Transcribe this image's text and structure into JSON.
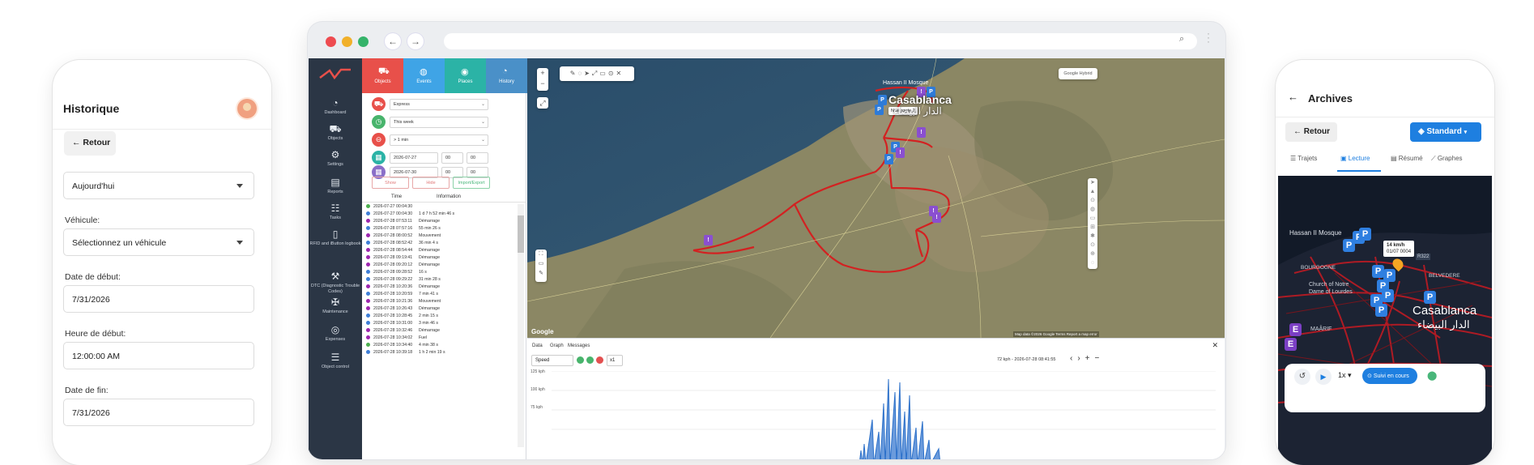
{
  "left_phone": {
    "title": "Historique",
    "back_label": "Retour",
    "period_value": "Aujourd'hui",
    "vehicle_label": "Véhicule:",
    "vehicle_value": "Sélectionnez un véhicule",
    "start_date_label": "Date de début:",
    "start_date_value": "7/31/2026",
    "start_time_label": "Heure de début:",
    "start_time_value": "12:00:00 AM",
    "end_date_label": "Date de fin:",
    "end_date_value": "7/31/2026"
  },
  "app": {
    "nav": [
      {
        "icon": "dashboard-icon",
        "label": "Dashboard"
      },
      {
        "icon": "car-icon",
        "label": "Objects"
      },
      {
        "icon": "gear-icon",
        "label": "Settings"
      },
      {
        "icon": "report-icon",
        "label": "Reports"
      },
      {
        "icon": "tasks-icon",
        "label": "Tasks"
      },
      {
        "icon": "book-icon",
        "label": "RFID and iButton logbook"
      },
      {
        "icon": "engine-icon",
        "label": "DTC (Diagnostic Trouble Codes)"
      },
      {
        "icon": "wrench-icon",
        "label": "Maintenance"
      },
      {
        "icon": "coins-icon",
        "label": "Expenses"
      },
      {
        "icon": "sliders-icon",
        "label": "Object control"
      }
    ],
    "tabs": [
      {
        "label": "Objects",
        "color": "#e8504a"
      },
      {
        "label": "Events",
        "color": "#3fa4e6"
      },
      {
        "label": "Places",
        "color": "#2bb3a6"
      },
      {
        "label": "History",
        "color": "#4a90c8"
      }
    ],
    "filters": {
      "object": "Express",
      "period": "This week",
      "stops": "> 1 min",
      "date_from": "2026-07-27",
      "date_to": "2026-07-30",
      "hour": "00",
      "minute": "00"
    },
    "buttons": {
      "show": "Show",
      "hide": "Hide",
      "import_export": "Import/Export"
    },
    "history_headers": {
      "time": "Time",
      "information": "Information"
    },
    "history_rows": [
      {
        "time": "2026-07-27 00:04:30",
        "info": "",
        "color": "#4caf50"
      },
      {
        "time": "2026-07-27 00:04:30",
        "info": "1 d 7 h 52 min 46 s",
        "color": "#3f7fd8"
      },
      {
        "time": "2026-07-28 07:53:11",
        "info": "Démarrage",
        "color": "#9c27b0"
      },
      {
        "time": "2026-07-28 07:57:16",
        "info": "55 min 26 s",
        "color": "#3f7fd8"
      },
      {
        "time": "2026-07-28 08:00:52",
        "info": "Mouvement",
        "color": "#9c27b0"
      },
      {
        "time": "2026-07-28 08:52:42",
        "info": "36 min 4 s",
        "color": "#3f7fd8"
      },
      {
        "time": "2026-07-28 08:54:44",
        "info": "Démarrage",
        "color": "#9c27b0"
      },
      {
        "time": "2026-07-28 09:19:41",
        "info": "Démarrage",
        "color": "#9c27b0"
      },
      {
        "time": "2026-07-28 09:20:12",
        "info": "Démarrage",
        "color": "#9c27b0"
      },
      {
        "time": "2026-07-28 09:28:52",
        "info": "16 s",
        "color": "#3f7fd8"
      },
      {
        "time": "2026-07-28 09:29:22",
        "info": "31 min 28 s",
        "color": "#3f7fd8"
      },
      {
        "time": "2026-07-28 10:20:36",
        "info": "Démarrage",
        "color": "#9c27b0"
      },
      {
        "time": "2026-07-28 10:20:59",
        "info": "7 min 41 s",
        "color": "#3f7fd8"
      },
      {
        "time": "2026-07-28 10:21:36",
        "info": "Mouvement",
        "color": "#9c27b0"
      },
      {
        "time": "2026-07-28 10:26:43",
        "info": "Démarrage",
        "color": "#9c27b0"
      },
      {
        "time": "2026-07-28 10:28:45",
        "info": "2 min 15 s",
        "color": "#3f7fd8"
      },
      {
        "time": "2026-07-28 10:31:00",
        "info": "3 min 46 s",
        "color": "#3f7fd8"
      },
      {
        "time": "2026-07-28 10:32:46",
        "info": "Démarrage",
        "color": "#9c27b0"
      },
      {
        "time": "2026-07-28 10:34:02",
        "info": "Fuel",
        "color": "#9c27b0"
      },
      {
        "time": "2026-07-28 10:34:40",
        "info": "4 min 38 s",
        "color": "#4caf50"
      },
      {
        "time": "2026-07-28 10:39:18",
        "info": "1 h 2 min 19 s",
        "color": "#3f7fd8"
      }
    ],
    "map": {
      "type_button": "Google Hybrid",
      "city_label": "Casablanca",
      "city_label_ar": "الدار البيضاء",
      "mosque_label": "Hassan II Mosque",
      "route_tooltip": "New route 2",
      "attribution": "Map data ©2026 Google   Terms   Report a map error",
      "google": "Google"
    },
    "bottom": {
      "tabs": [
        "Data",
        "Graph",
        "Messages"
      ],
      "sensor": "Speed",
      "multiplier": "x1",
      "readout": "72 kph - 2026-07-28 08:41:55",
      "y_ticks": [
        "125 kph",
        "100 kph",
        "75 kph"
      ]
    }
  },
  "right_phone": {
    "title": "Archives",
    "back_label": "Retour",
    "standard_label": "Standard",
    "tabs": [
      "Trajets",
      "Lecture",
      "Résumé",
      "Graphes"
    ],
    "map": {
      "mosque_label": "Hassan II Mosque",
      "bourgogne": "BOURGOGNE",
      "church": "Church of Notre Dame of Lourdes",
      "maarif": "MAÂRIF",
      "belvedere": "BELVEDERE",
      "city": "Casablanca",
      "city_ar": "الدار البيضاء",
      "speed": "14 km/h",
      "speed_date": "01/07 0004",
      "road": "R322"
    },
    "controls": {
      "speed": "1x",
      "follow": "Suivi en cours"
    }
  }
}
